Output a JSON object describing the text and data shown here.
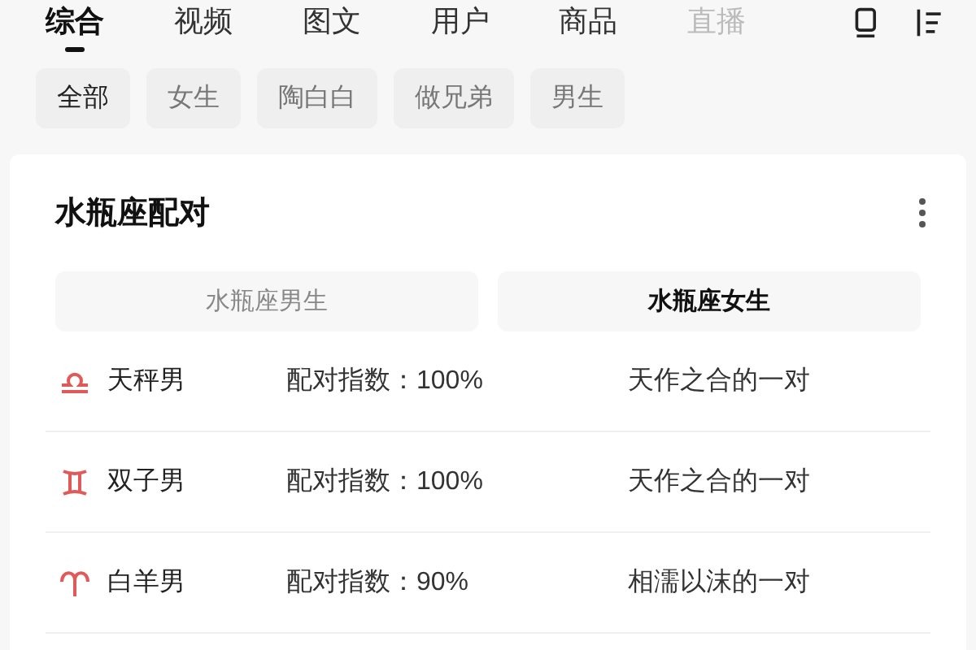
{
  "tabs": [
    {
      "label": "综合",
      "selected": true,
      "faded": false
    },
    {
      "label": "视频",
      "selected": false,
      "faded": false
    },
    {
      "label": "图文",
      "selected": false,
      "faded": false
    },
    {
      "label": "用户",
      "selected": false,
      "faded": false
    },
    {
      "label": "商品",
      "selected": false,
      "faded": false
    },
    {
      "label": "直播",
      "selected": false,
      "faded": true
    }
  ],
  "chips": [
    {
      "label": "全部",
      "selected": true
    },
    {
      "label": "女生",
      "selected": false
    },
    {
      "label": "陶白白",
      "selected": false
    },
    {
      "label": "做兄弟",
      "selected": false
    },
    {
      "label": "男生",
      "selected": false
    }
  ],
  "card": {
    "title": "水瓶座配对",
    "segments": [
      {
        "label": "水瓶座男生",
        "selected": false
      },
      {
        "label": "水瓶座女生",
        "selected": true
      }
    ],
    "rows": [
      {
        "kind": "libra",
        "name": "天秤男",
        "score": "配对指数：100%",
        "description": "天作之合的一对"
      },
      {
        "kind": "gemini",
        "name": "双子男",
        "score": "配对指数：100%",
        "description": "天作之合的一对"
      },
      {
        "kind": "aries",
        "name": "白羊男",
        "score": "配对指数：90%",
        "description": "相濡以沫的一对"
      }
    ]
  }
}
